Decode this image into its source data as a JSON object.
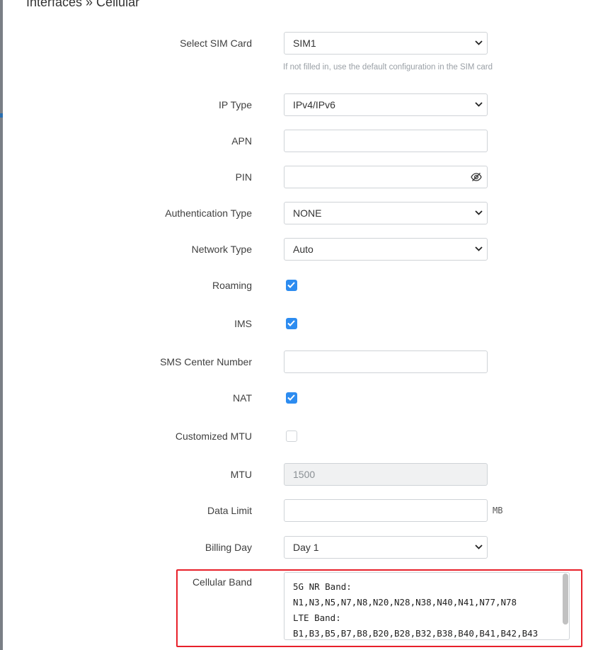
{
  "header": {
    "title": "Interfaces » Cellular"
  },
  "form": {
    "sim_card": {
      "label": "Select SIM Card",
      "value": "SIM1",
      "hint": "If not filled in, use the default configuration in the SIM card"
    },
    "ip_type": {
      "label": "IP Type",
      "value": "IPv4/IPv6"
    },
    "apn": {
      "label": "APN",
      "value": ""
    },
    "pin": {
      "label": "PIN",
      "value": ""
    },
    "auth_type": {
      "label": "Authentication Type",
      "value": "NONE"
    },
    "network_type": {
      "label": "Network Type",
      "value": "Auto"
    },
    "roaming": {
      "label": "Roaming",
      "checked": true
    },
    "ims": {
      "label": "IMS",
      "checked": true
    },
    "sms_center": {
      "label": "SMS Center Number",
      "value": ""
    },
    "nat": {
      "label": "NAT",
      "checked": true
    },
    "custom_mtu": {
      "label": "Customized MTU",
      "checked": false
    },
    "mtu": {
      "label": "MTU",
      "value": "1500"
    },
    "data_limit": {
      "label": "Data Limit",
      "value": "",
      "unit": "MB"
    },
    "billing_day": {
      "label": "Billing Day",
      "value": "Day 1"
    },
    "cellular_band": {
      "label": "Cellular Band",
      "lines": [
        "5G NR Band:",
        "N1,N3,N5,N7,N8,N20,N28,N38,N40,N41,N77,N78",
        "LTE Band:",
        "B1,B3,B5,B7,B8,B20,B28,B32,B38,B40,B41,B42,B43"
      ]
    }
  },
  "colors": {
    "accent": "#2d8cf0",
    "highlight_border": "#e8202a"
  }
}
